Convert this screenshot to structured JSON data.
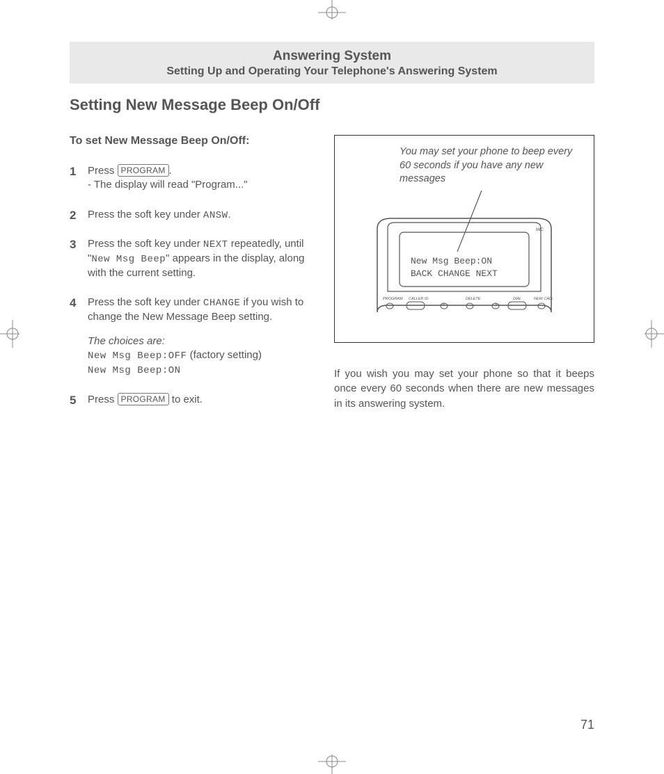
{
  "header": {
    "title": "Answering System",
    "subtitle": "Setting Up and Operating Your Telephone's Answering System"
  },
  "section_title": "Setting New Message Beep On/Off",
  "intro": "To set New Message Beep On/Off:",
  "keycap_program": "PROGRAM",
  "lcd": {
    "answ": "ANSW",
    "next": "NEXT",
    "new_msg_beep": "New Msg Beep",
    "change": "CHANGE",
    "off": "New Msg Beep:OFF",
    "on": "New Msg Beep:ON",
    "screen_line1": "New Msg Beep:ON",
    "screen_line2": "BACK CHANGE NEXT"
  },
  "steps": {
    "s1a": "Press ",
    "s1b": ".",
    "s1c": "- The display will read \"Program...\"",
    "s2a": "Press the soft key under ",
    "s2b": ".",
    "s3a": "Press the soft key under ",
    "s3b": " repeatedly, until \"",
    "s3c": "\" appears in the display, along with the current setting.",
    "s4a": "Press the soft key under ",
    "s4b": " if you wish to change the New Message Beep setting.",
    "choices_label": "The choices are:",
    "s4_off_suffix": " (factory setting)",
    "s5a": "Press ",
    "s5b": "  to exit."
  },
  "figure_caption": "You may set your phone to beep every 60 seconds if you have any new messages",
  "phone_labels": {
    "mic": "MIC",
    "program": "PROGRAM",
    "callerid": "CALLER ID",
    "delete": "DELETE",
    "dial": "DIAL",
    "newcall": "NEW CALL"
  },
  "body_para": "If you wish you may set your phone so that it beeps once every 60 seconds when there are new messages in its answering system.",
  "page_number": "71"
}
